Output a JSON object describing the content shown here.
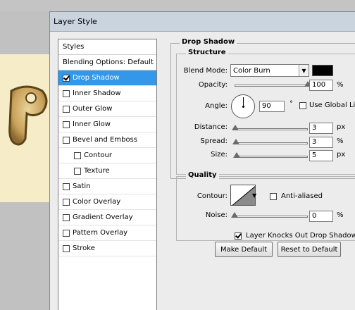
{
  "window": {
    "title": "Layer Style"
  },
  "style_list": {
    "header": "Styles",
    "items": [
      {
        "label": "Blending Options: Default",
        "checkbox": false,
        "checked": false,
        "selected": false
      },
      {
        "label": "Drop Shadow",
        "checkbox": true,
        "checked": true,
        "selected": true
      },
      {
        "label": "Inner Shadow",
        "checkbox": true,
        "checked": false,
        "selected": false
      },
      {
        "label": "Outer Glow",
        "checkbox": true,
        "checked": false,
        "selected": false
      },
      {
        "label": "Inner Glow",
        "checkbox": true,
        "checked": false,
        "selected": false
      },
      {
        "label": "Bevel and Emboss",
        "checkbox": true,
        "checked": false,
        "selected": false
      },
      {
        "label": "Contour",
        "checkbox": true,
        "checked": false,
        "selected": false,
        "sub": true
      },
      {
        "label": "Texture",
        "checkbox": true,
        "checked": false,
        "selected": false,
        "sub": true
      },
      {
        "label": "Satin",
        "checkbox": true,
        "checked": false,
        "selected": false
      },
      {
        "label": "Color Overlay",
        "checkbox": true,
        "checked": false,
        "selected": false
      },
      {
        "label": "Gradient Overlay",
        "checkbox": true,
        "checked": false,
        "selected": false
      },
      {
        "label": "Pattern Overlay",
        "checkbox": true,
        "checked": false,
        "selected": false
      },
      {
        "label": "Stroke",
        "checkbox": true,
        "checked": false,
        "selected": false
      }
    ]
  },
  "drop_shadow": {
    "group_title": "Drop Shadow",
    "structure": {
      "title": "Structure",
      "blend_mode_label": "Blend Mode:",
      "blend_mode_value": "Color Burn",
      "shadow_color": "#000000",
      "opacity_label": "Opacity:",
      "opacity_value": "100",
      "opacity_unit": "%",
      "opacity_level": 1.0,
      "angle_label": "Angle:",
      "angle_value": "90",
      "angle_unit": "°",
      "use_global_light_label": "Use Global Lig",
      "use_global_light_checked": false,
      "distance_label": "Distance:",
      "distance_value": "3",
      "distance_unit": "px",
      "spread_label": "Spread:",
      "spread_value": "3",
      "spread_unit": "%",
      "size_label": "Size:",
      "size_value": "5",
      "size_unit": "px"
    },
    "quality": {
      "title": "Quality",
      "contour_label": "Contour:",
      "anti_aliased_label": "Anti-aliased",
      "anti_aliased_checked": false,
      "noise_label": "Noise:",
      "noise_value": "0",
      "noise_unit": "%"
    },
    "knockout_label": "Layer Knocks Out Drop Shadow",
    "knockout_checked": true,
    "make_default_label": "Make Default",
    "reset_default_label": "Reset to Default"
  },
  "colors": {
    "selection": "#3398ea",
    "dialog_bg": "#ececec",
    "titlebar": "#c9d4df"
  }
}
